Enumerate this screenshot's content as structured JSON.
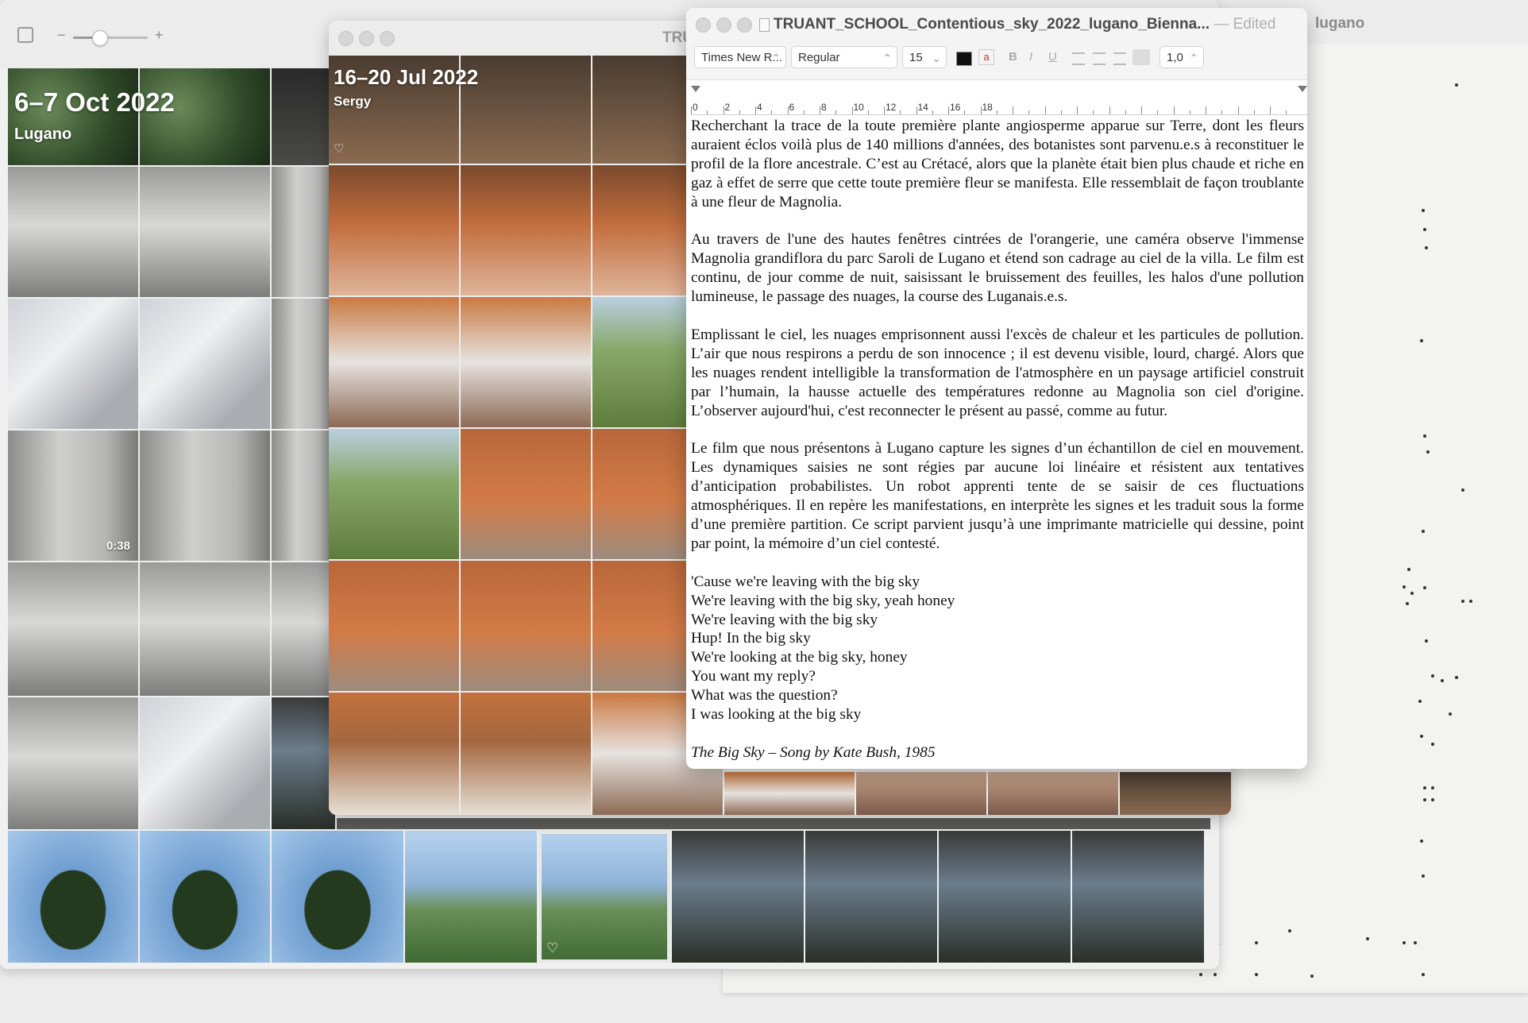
{
  "photos_main": {
    "group_title": "6–7 Oct 2022",
    "group_location": "Lugano",
    "video_duration": "0:38",
    "zoom_minus": "−",
    "zoom_plus": "+",
    "zoom_level": 0.35,
    "partial_title": "lugano"
  },
  "photos_second": {
    "partial_title": "TRU",
    "group_title": "16–20 Jul 2022",
    "group_location": "Sergy"
  },
  "textedit": {
    "window_title": "TRUANT_SCHOOL_Contentious_sky_2022_lugano_Bienna...",
    "status": "— Edited",
    "font_family": "Times New R...",
    "font_style": "Regular",
    "font_size": "15",
    "line_spacing": "1,0",
    "bold_label": "B",
    "italic_label": "I",
    "underline_label": "U",
    "ruler_numbers": [
      "0",
      "2",
      "4",
      "6",
      "8",
      "10",
      "12",
      "14",
      "16",
      "18"
    ],
    "paragraphs": [
      "Recherchant la trace de la toute première plante angiosperme apparue sur Terre, dont les fleurs auraient éclos voilà plus de 140 millions d'années, des botanistes sont parvenu.e.s à reconstituer le profil de la flore ancestrale. C’est au Crétacé, alors que la planète était bien plus chaude et riche en gaz à effet de serre que cette toute première fleur se manifesta. Elle ressemblait de façon troublante à une fleur de Magnolia.",
      "Au travers de l'une des hautes fenêtres cintrées de l'orangerie, une caméra observe l'immense Magnolia grandiflora du parc Saroli de Lugano et étend son cadrage au ciel de la villa. Le film est continu, de jour comme de nuit, saisissant le bruissement des feuilles, les halos d'une pollution lumineuse, le passage des nuages, la course des Luganais.e.s.",
      "Emplissant le ciel, les nuages emprisonnent aussi l'excès de chaleur et les particules de pollution. L’air que nous respirons a perdu de son innocence ; il est devenu visible, lourd, chargé. Alors que les nuages rendent intelligible la transformation de l'atmosphère en un paysage artificiel construit par l’humain, la hausse actuelle des températures redonne au Magnolia son ciel d'origine. L’observer aujourd'hui, c'est reconnecter le présent au passé, comme au futur.",
      "Le film que nous présentons à Lugano capture les signes d’un échantillon de ciel en mouvement. Les dynamiques saisies ne sont régies par aucune loi linéaire et résistent aux tentatives d’anticipation probabilistes. Un robot apprenti tente de se saisir de ces fluctuations atmosphériques. Il en repère les manifestations, en interprète les signes et les traduit sous la forme d’une première partition. Ce script parvient jusqu’à une imprimante matricielle qui dessine, point par point, la mémoire d’un ciel contesté."
    ],
    "lyrics": [
      "'Cause we're leaving with the big sky",
      "We're leaving with the big sky, yeah honey",
      "We're leaving with the big sky",
      "Hup! In the big sky",
      "We're looking at the big sky, honey",
      "You want my reply?",
      "What was the question?",
      "I was looking at the big sky"
    ],
    "credit": "The Big Sky – Song by Kate Bush, 1985"
  },
  "icons": [
    "sidebar-toggle-icon",
    "heart-icon",
    "document-icon",
    "color-well-icon",
    "text-color-icon",
    "align-left-icon",
    "align-center-icon",
    "align-right-icon",
    "justify-icon"
  ]
}
